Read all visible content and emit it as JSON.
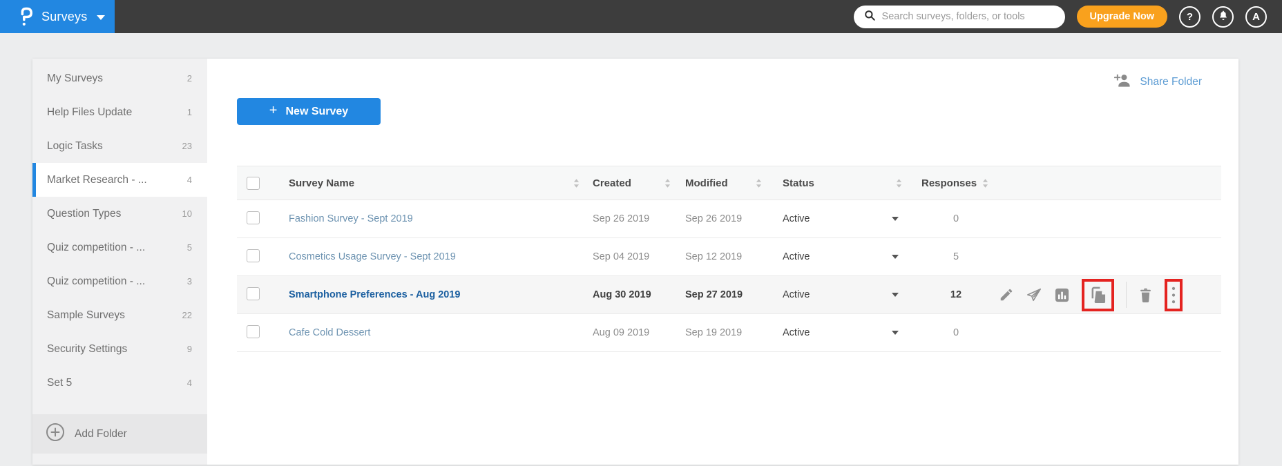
{
  "topbar": {
    "app_name": "Surveys",
    "search_placeholder": "Search surveys, folders, or tools",
    "upgrade_label": "Upgrade Now",
    "help_label": "?",
    "avatar_letter": "A"
  },
  "sidebar": {
    "items": [
      {
        "label": "My Surveys",
        "count": "2",
        "active": false
      },
      {
        "label": "Help Files Update",
        "count": "1",
        "active": false
      },
      {
        "label": "Logic Tasks",
        "count": "23",
        "active": false
      },
      {
        "label": "Market Research - ...",
        "count": "4",
        "active": true
      },
      {
        "label": "Question Types",
        "count": "10",
        "active": false
      },
      {
        "label": "Quiz competition - ...",
        "count": "5",
        "active": false
      },
      {
        "label": "Quiz competition - ...",
        "count": "3",
        "active": false
      },
      {
        "label": "Sample Surveys",
        "count": "22",
        "active": false
      },
      {
        "label": "Security Settings",
        "count": "9",
        "active": false
      },
      {
        "label": "Set 5",
        "count": "4",
        "active": false
      }
    ],
    "add_folder_label": "Add Folder"
  },
  "main": {
    "share_folder_label": "Share Folder",
    "new_survey_label": "New Survey",
    "new_survey_plus": "+",
    "table": {
      "headers": [
        "Survey Name",
        "Created",
        "Modified",
        "Status",
        "Responses"
      ],
      "rows": [
        {
          "name": "Fashion Survey - Sept 2019",
          "created": "Sep 26 2019",
          "modified": "Sep 26 2019",
          "status": "Active",
          "responses": "0",
          "highlight": false
        },
        {
          "name": "Cosmetics Usage Survey - Sept 2019",
          "created": "Sep 04 2019",
          "modified": "Sep 12 2019",
          "status": "Active",
          "responses": "5",
          "highlight": false
        },
        {
          "name": "Smartphone Preferences - Aug 2019",
          "created": "Aug 30 2019",
          "modified": "Sep 27 2019",
          "status": "Active",
          "responses": "12",
          "highlight": true
        },
        {
          "name": "Cafe Cold Dessert",
          "created": "Aug 09 2019",
          "modified": "Sep 19 2019",
          "status": "Active",
          "responses": "0",
          "highlight": false
        }
      ],
      "row_action_icons": [
        "edit",
        "send",
        "reports",
        "copy",
        "delete",
        "more-options"
      ],
      "annotated_icons": [
        "copy",
        "more-options"
      ]
    }
  },
  "colors": {
    "topbar_bg": "#3d3d3d",
    "brand_blue": "#2287e1",
    "accent_orange": "#f9a11d",
    "link_blue": "#6d93b1",
    "active_link_blue": "#1b5fa0",
    "share_link_blue": "#5b9bd3",
    "annotation_red": "#e42320",
    "icon_gray": "#909090"
  }
}
